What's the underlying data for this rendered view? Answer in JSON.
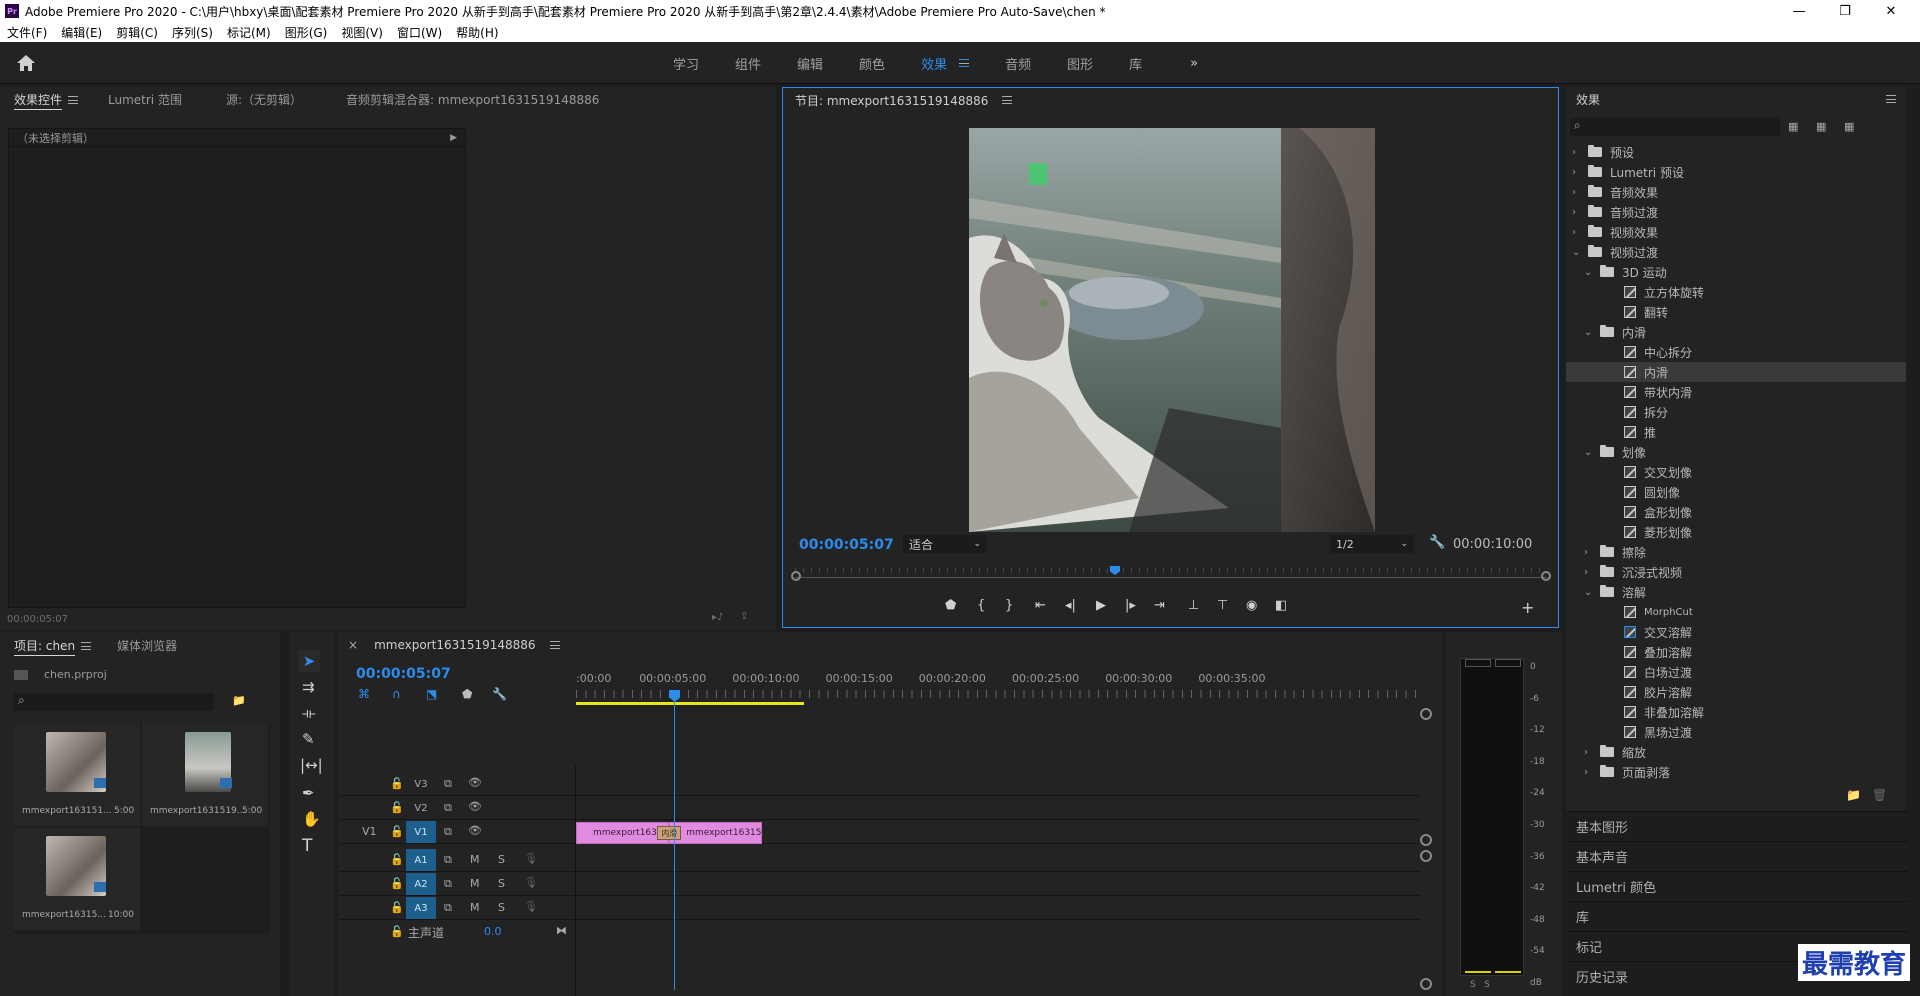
{
  "window": {
    "title": "Adobe Premiere Pro 2020 - C:\\用户\\hbxy\\桌面\\配套素材 Premiere Pro 2020 从新手到高手\\配套素材 Premiere Pro 2020 从新手到高手\\第2章\\2.4.4\\素材\\Adobe Premiere Pro Auto-Save\\chen *",
    "logo": "Pr",
    "minimize": "—",
    "restore": "❐",
    "close": "✕"
  },
  "menu": [
    "文件(F)",
    "编辑(E)",
    "剪辑(C)",
    "序列(S)",
    "标记(M)",
    "图形(G)",
    "视图(V)",
    "窗口(W)",
    "帮助(H)"
  ],
  "workspaces": {
    "tabs": [
      "学习",
      "组件",
      "编辑",
      "颜色",
      "效果",
      "音频",
      "图形",
      "库"
    ],
    "active": "效果",
    "more": "»"
  },
  "effect_controls": {
    "tabs": [
      "效果控件",
      "Lumetri 范围",
      "源:（无剪辑）",
      "音频剪辑混合器: mmexport1631519148886"
    ],
    "no_clip": "（未选择剪辑）",
    "timecode": "00:00:05:07"
  },
  "program": {
    "title": "节目: mmexport1631519148886",
    "timecode": "00:00:05:07",
    "fit": "适合",
    "res": "1/2",
    "duration": "00:00:10:00"
  },
  "project": {
    "tabs": [
      "项目: chen",
      "媒体浏览器"
    ],
    "file": "chen.prproj",
    "items": [
      {
        "name": "mmexport163151...",
        "dur": "5:00"
      },
      {
        "name": "mmexport1631519...",
        "dur": "5:00"
      },
      {
        "name": "mmexport16315...",
        "dur": "10:00"
      }
    ]
  },
  "timeline": {
    "title": "mmexport1631519148886",
    "timecode": "00:00:05:07",
    "ruler": [
      ":00:00",
      "00:00:05:00",
      "00:00:10:00",
      "00:00:15:00",
      "00:00:20:00",
      "00:00:25:00",
      "00:00:30:00",
      "00:00:35:00"
    ],
    "video_tracks": [
      "V3",
      "V2",
      "V1"
    ],
    "audio_tracks": [
      "A1",
      "A2",
      "A3"
    ],
    "source_patch": "V1",
    "master": "主声道",
    "master_value": "0.0",
    "mute": "M",
    "solo": "S",
    "clips": [
      {
        "name": "mmexport163151",
        "start": 0,
        "end": 5.0
      },
      {
        "name": "mmexport163151",
        "start": 5.0,
        "end": 10.0
      }
    ],
    "transition_label": "内滑",
    "playhead_seconds": 5.27
  },
  "meter": {
    "scale": [
      "0",
      "-6",
      "-12",
      "-18",
      "-24",
      "-30",
      "-36",
      "-42",
      "-48",
      "-54",
      "dB"
    ],
    "footer": "S   S"
  },
  "effects": {
    "title": "效果",
    "tree": [
      {
        "label": "预设",
        "level": 0,
        "type": "folder",
        "open": false
      },
      {
        "label": "Lumetri 预设",
        "level": 0,
        "type": "folder",
        "open": false
      },
      {
        "label": "音频效果",
        "level": 0,
        "type": "folder",
        "open": false
      },
      {
        "label": "音频过渡",
        "level": 0,
        "type": "folder",
        "open": false
      },
      {
        "label": "视频效果",
        "level": 0,
        "type": "folder",
        "open": false
      },
      {
        "label": "视频过渡",
        "level": 0,
        "type": "folder",
        "open": true
      },
      {
        "label": "3D 运动",
        "level": 1,
        "type": "folder",
        "open": true
      },
      {
        "label": "立方体旋转",
        "level": 2,
        "type": "fx"
      },
      {
        "label": "翻转",
        "level": 2,
        "type": "fx"
      },
      {
        "label": "内滑",
        "level": 1,
        "type": "folder",
        "open": true
      },
      {
        "label": "中心拆分",
        "level": 2,
        "type": "fx"
      },
      {
        "label": "内滑",
        "level": 2,
        "type": "fx",
        "selected": true
      },
      {
        "label": "带状内滑",
        "level": 2,
        "type": "fx"
      },
      {
        "label": "拆分",
        "level": 2,
        "type": "fx"
      },
      {
        "label": "推",
        "level": 2,
        "type": "fx"
      },
      {
        "label": "划像",
        "level": 1,
        "type": "folder",
        "open": true
      },
      {
        "label": "交叉划像",
        "level": 2,
        "type": "fx"
      },
      {
        "label": "圆划像",
        "level": 2,
        "type": "fx"
      },
      {
        "label": "盒形划像",
        "level": 2,
        "type": "fx"
      },
      {
        "label": "菱形划像",
        "level": 2,
        "type": "fx"
      },
      {
        "label": "擦除",
        "level": 1,
        "type": "folder",
        "open": false
      },
      {
        "label": "沉浸式视频",
        "level": 1,
        "type": "folder",
        "open": false
      },
      {
        "label": "溶解",
        "level": 1,
        "type": "folder",
        "open": true
      },
      {
        "label": "MorphCut",
        "level": 2,
        "type": "fx"
      },
      {
        "label": "交叉溶解",
        "level": 2,
        "type": "fx",
        "default": true
      },
      {
        "label": "叠加溶解",
        "level": 2,
        "type": "fx"
      },
      {
        "label": "白场过渡",
        "level": 2,
        "type": "fx"
      },
      {
        "label": "胶片溶解",
        "level": 2,
        "type": "fx"
      },
      {
        "label": "非叠加溶解",
        "level": 2,
        "type": "fx"
      },
      {
        "label": "黑场过渡",
        "level": 2,
        "type": "fx"
      },
      {
        "label": "缩放",
        "level": 1,
        "type": "folder",
        "open": false
      },
      {
        "label": "页面剥落",
        "level": 1,
        "type": "folder",
        "open": false
      }
    ],
    "sections": [
      "基本图形",
      "基本声音",
      "Lumetri 颜色",
      "库",
      "标记",
      "历史记录"
    ]
  },
  "watermark": "最需教育",
  "colors": {
    "accent": "#2d8ceb",
    "clip": "#e08be0",
    "panel": "#232323",
    "bg": "#1d1d1d"
  }
}
